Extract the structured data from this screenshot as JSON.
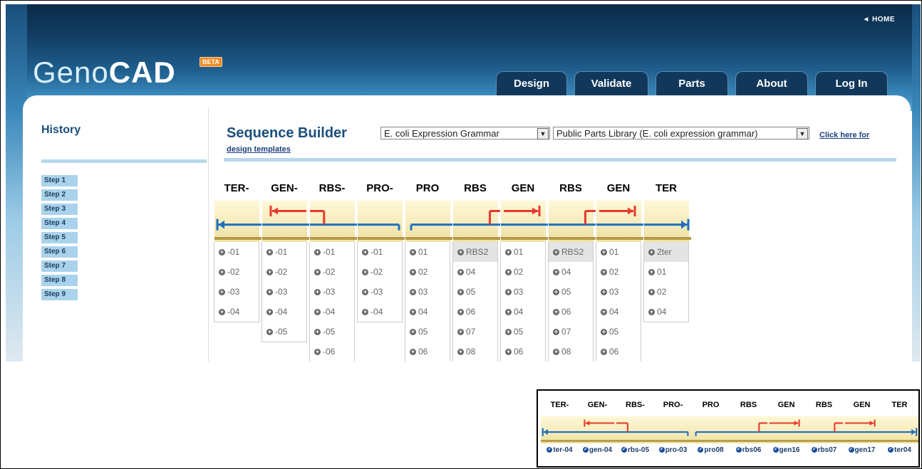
{
  "header": {
    "home_link": "◄ HOME",
    "logo_light": "Geno",
    "logo_bold": "CAD",
    "beta": "BETA",
    "tabs": [
      "Design",
      "Validate",
      "Parts",
      "About",
      "Log In"
    ]
  },
  "sidebar": {
    "title": "History",
    "steps": [
      "Step 1",
      "Step 2",
      "Step 3",
      "Step 4",
      "Step 5",
      "Step 6",
      "Step 7",
      "Step 8",
      "Step 9"
    ]
  },
  "builder": {
    "title": "Sequence Builder",
    "grammar_select": "E. coli Expression Grammar",
    "library_select": "Public Parts Library (E. coli expression grammar)",
    "template_link_1": "Click here for",
    "template_link_2": "design templates"
  },
  "columns": [
    {
      "header": "TER-",
      "glyph": "ter-rev",
      "parts": [
        "-01",
        "-02",
        "-03",
        "-04"
      ]
    },
    {
      "header": "GEN-",
      "glyph": "gen-rev",
      "parts": [
        "-01",
        "-02",
        "-03",
        "-04",
        "-05"
      ]
    },
    {
      "header": "RBS-",
      "glyph": "rbs-rev",
      "parts": [
        "-01",
        "-02",
        "-03",
        "-04",
        "-05",
        "-06"
      ]
    },
    {
      "header": "PRO-",
      "glyph": "pro-rev",
      "parts": [
        "-01",
        "-02",
        "-03",
        "-04"
      ]
    },
    {
      "header": "PRO",
      "glyph": "pro",
      "parts": [
        "01",
        "02",
        "03",
        "04",
        "05",
        "06"
      ]
    },
    {
      "header": "RBS",
      "glyph": "rbs",
      "selected": "RBS2",
      "parts": [
        "04",
        "05",
        "06",
        "07",
        "08"
      ]
    },
    {
      "header": "GEN",
      "glyph": "gen",
      "parts": [
        "01",
        "02",
        "03",
        "04",
        "05",
        "06"
      ]
    },
    {
      "header": "RBS",
      "glyph": "rbs",
      "selected": "RBS2",
      "parts": [
        "04",
        "05",
        "06",
        "07",
        "08"
      ]
    },
    {
      "header": "GEN",
      "glyph": "gen",
      "parts": [
        "01",
        "02",
        "03",
        "04",
        "05",
        "06"
      ]
    },
    {
      "header": "TER",
      "glyph": "ter",
      "selected": "2ter",
      "parts": [
        "01",
        "02",
        "04"
      ]
    }
  ],
  "inset": {
    "columns": [
      {
        "header": "TER-",
        "glyph": "ter-rev",
        "part": "ter-04"
      },
      {
        "header": "GEN-",
        "glyph": "gen-rev",
        "part": "gen-04"
      },
      {
        "header": "RBS-",
        "glyph": "rbs-rev",
        "part": "rbs-05"
      },
      {
        "header": "PRO-",
        "glyph": "pro-rev",
        "part": "pro-03"
      },
      {
        "header": "PRO",
        "glyph": "pro",
        "part": "pro08"
      },
      {
        "header": "RBS",
        "glyph": "rbs",
        "part": "rbs06"
      },
      {
        "header": "GEN",
        "glyph": "gen",
        "part": "gen16"
      },
      {
        "header": "RBS",
        "glyph": "rbs",
        "part": "rbs07"
      },
      {
        "header": "GEN",
        "glyph": "gen",
        "part": "gen17"
      },
      {
        "header": "TER",
        "glyph": "ter",
        "part": "ter04"
      }
    ]
  },
  "colors": {
    "backbone": "#1f6fc0",
    "feature": "#e8392c",
    "header_dark": "#0b2b49",
    "accent": "#1a4f7c"
  }
}
